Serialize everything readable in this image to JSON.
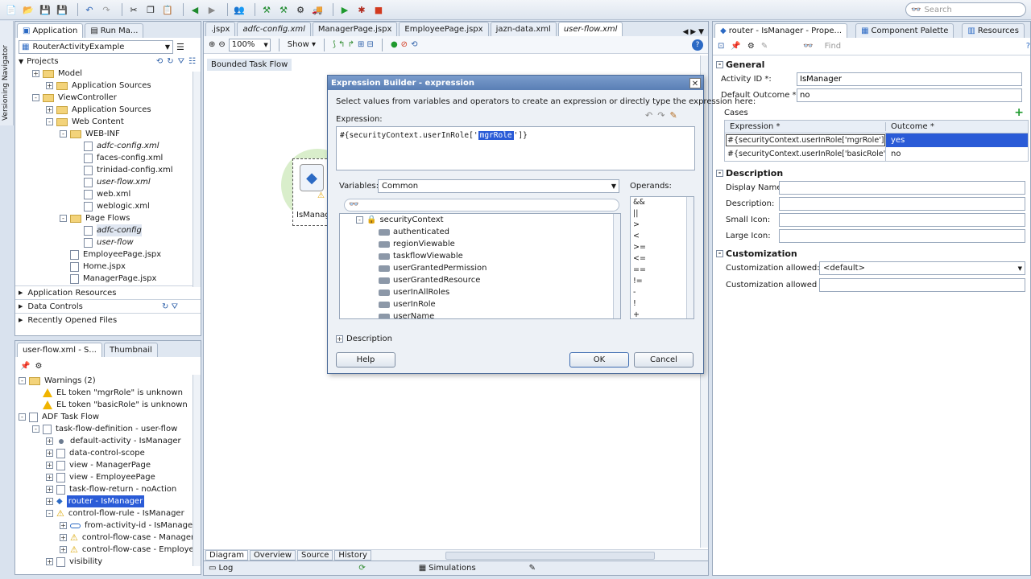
{
  "toolbar": {
    "search_placeholder": "Search"
  },
  "left_panel": {
    "tabs": [
      "Application",
      "Run Ma..."
    ],
    "vertical_label": "Versioning Navigator",
    "app_selector": "RouterActivityExample",
    "projects_label": "Projects",
    "tree": [
      {
        "label": "Model",
        "indent": 1,
        "icon": "folder",
        "exp": "+"
      },
      {
        "label": "Application Sources",
        "indent": 2,
        "icon": "folder",
        "exp": "+"
      },
      {
        "label": "ViewController",
        "indent": 1,
        "icon": "folder",
        "exp": "-"
      },
      {
        "label": "Application Sources",
        "indent": 2,
        "icon": "folder",
        "exp": "+"
      },
      {
        "label": "Web Content",
        "indent": 2,
        "icon": "folder",
        "exp": "-"
      },
      {
        "label": "WEB-INF",
        "indent": 3,
        "icon": "folder",
        "exp": "-"
      },
      {
        "label": "adfc-config.xml",
        "indent": 4,
        "icon": "file",
        "italic": true
      },
      {
        "label": "faces-config.xml",
        "indent": 4,
        "icon": "file"
      },
      {
        "label": "trinidad-config.xml",
        "indent": 4,
        "icon": "file"
      },
      {
        "label": "user-flow.xml",
        "indent": 4,
        "icon": "file",
        "italic": true
      },
      {
        "label": "web.xml",
        "indent": 4,
        "icon": "file"
      },
      {
        "label": "weblogic.xml",
        "indent": 4,
        "icon": "file"
      },
      {
        "label": "Page Flows",
        "indent": 3,
        "icon": "folder",
        "exp": "-"
      },
      {
        "label": "adfc-config",
        "indent": 4,
        "icon": "file",
        "italic": true,
        "highlight": true
      },
      {
        "label": "user-flow",
        "indent": 4,
        "icon": "file",
        "italic": true
      },
      {
        "label": "EmployeePage.jspx",
        "indent": 3,
        "icon": "file"
      },
      {
        "label": "Home.jspx",
        "indent": 3,
        "icon": "file"
      },
      {
        "label": "ManagerPage.jspx",
        "indent": 3,
        "icon": "file"
      }
    ],
    "accordions": [
      "Application Resources",
      "Data Controls",
      "Recently Opened Files"
    ]
  },
  "structure_panel": {
    "tabs": [
      "user-flow.xml - S...",
      "Thumbnail"
    ],
    "tree": [
      {
        "label": "Warnings (2)",
        "indent": 0,
        "icon": "folder",
        "exp": "-"
      },
      {
        "label": "EL token \"mgrRole\" is unknown",
        "indent": 1,
        "icon": "warn"
      },
      {
        "label": "EL token \"basicRole\" is unknown",
        "indent": 1,
        "icon": "warn"
      },
      {
        "label": "ADF Task Flow",
        "indent": 0,
        "icon": "file",
        "exp": "-"
      },
      {
        "label": "task-flow-definition - user-flow",
        "indent": 1,
        "icon": "file",
        "exp": "-"
      },
      {
        "label": "default-activity - IsManager",
        "indent": 2,
        "icon": "dot",
        "exp": "+"
      },
      {
        "label": "data-control-scope",
        "indent": 2,
        "icon": "file",
        "exp": "+"
      },
      {
        "label": "view - ManagerPage",
        "indent": 2,
        "icon": "file",
        "exp": "+"
      },
      {
        "label": "view - EmployeePage",
        "indent": 2,
        "icon": "file",
        "exp": "+"
      },
      {
        "label": "task-flow-return - noAction",
        "indent": 2,
        "icon": "file",
        "exp": "+"
      },
      {
        "label": "router - IsManager",
        "indent": 2,
        "icon": "router",
        "exp": "+",
        "selected": true
      },
      {
        "label": "control-flow-rule - IsManager",
        "indent": 2,
        "icon": "warnc",
        "exp": "-"
      },
      {
        "label": "from-activity-id - IsManager",
        "indent": 3,
        "icon": "pill",
        "exp": "+"
      },
      {
        "label": "control-flow-case - ManagerPa",
        "indent": 3,
        "icon": "warnc",
        "exp": "+"
      },
      {
        "label": "control-flow-case - EmployeeP",
        "indent": 3,
        "icon": "warnc",
        "exp": "+"
      },
      {
        "label": "visibility",
        "indent": 2,
        "icon": "file",
        "exp": "+"
      }
    ]
  },
  "editor": {
    "tabs": [
      ".jspx",
      "adfc-config.xml",
      "ManagerPage.jspx",
      "EmployeePage.jspx",
      "jazn-data.xml",
      "user-flow.xml"
    ],
    "zoom": "100%",
    "show_label": "Show",
    "bounded_label": "Bounded Task Flow",
    "node_label": "IsManag",
    "bottom_tabs": [
      "Diagram",
      "Overview",
      "Source",
      "History"
    ]
  },
  "dialog": {
    "title": "Expression Builder - expression",
    "instruction": "Select values from variables and operators to create an expression or directly type the expression here:",
    "expression_label": "Expression:",
    "expression_prefix": "#{securityContext.userInRole['",
    "expression_selected": "mgrRole",
    "expression_suffix": "']}",
    "variables_label": "Variables:",
    "variables_value": "Common",
    "operands_label": "Operands:",
    "tree_root": "securityContext",
    "tree_items": [
      "authenticated",
      "regionViewable",
      "taskflowViewable",
      "userGrantedPermission",
      "userGrantedResource",
      "userInAllRoles",
      "userInRole",
      "userName"
    ],
    "operands": [
      "&&",
      "||",
      ">",
      "<",
      ">=",
      "<=",
      "==",
      "!=",
      "-",
      "!",
      "+"
    ],
    "description_label": "Description",
    "help_button": "Help",
    "ok_button": "OK",
    "cancel_button": "Cancel"
  },
  "right_panel": {
    "tabs": [
      "router - IsManager - Prope...",
      "Component Palette",
      "Resources"
    ],
    "find_placeholder": "Find",
    "general_label": "General",
    "activity_id_label": "Activity ID *:",
    "activity_id_value": "IsManager",
    "default_outcome_label": "Default Outcome *:",
    "default_outcome_value": "no",
    "cases_label": "Cases",
    "cases_headers": [
      "Expression *",
      "Outcome *"
    ],
    "cases_rows": [
      {
        "expr": "#{securityContext.userInRole['mgrRole']}",
        "outcome": "yes",
        "selected": true
      },
      {
        "expr": "#{securityContext.userInRole['basicRole']}",
        "outcome": "no",
        "selected": false
      }
    ],
    "description_label": "Description",
    "display_name_label": "Display Name:",
    "description_field_label": "Description:",
    "small_icon_label": "Small Icon:",
    "large_icon_label": "Large Icon:",
    "customization_label": "Customization",
    "customization_allowed_label": "Customization allowed:",
    "customization_allowed_value": "<default>",
    "customization_allowed_by_label": "Customization allowed by:"
  },
  "status_bar": {
    "log_label": "Log",
    "simulations_label": "Simulations"
  }
}
